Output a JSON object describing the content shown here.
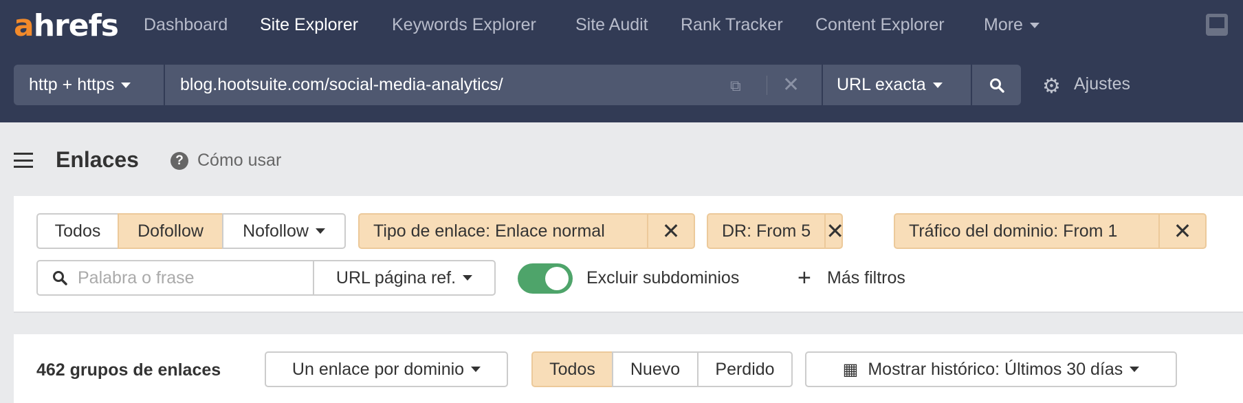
{
  "header": {
    "logo": "ahrefs",
    "logo_accent": "a",
    "logo_rest": "hrefs",
    "nav": [
      "Dashboard",
      "Site Explorer",
      "Keywords Explorer",
      "Site Audit",
      "Rank Tracker",
      "Content Explorer",
      "More"
    ],
    "active": "Site Explorer"
  },
  "search": {
    "protocol": "http + https",
    "url": "blog.hootsuite.com/social-media-analytics/",
    "mode": "URL exacta",
    "settings": "Ajustes"
  },
  "page": {
    "title": "Enlaces",
    "howto": "Cómo usar"
  },
  "filters": {
    "link_types": [
      "Todos",
      "Dofollow",
      "Nofollow"
    ],
    "selected_link_type": "Dofollow",
    "chips": [
      "Tipo de enlace: Enlace normal",
      "DR: From 5",
      "Tráfico del dominio: From 1"
    ],
    "search_placeholder": "Palabra o frase",
    "search_scope": "URL página ref.",
    "exclude_subdomains": "Excluir subdominios",
    "exclude_subdomains_on": true,
    "more_filters": "Más filtros"
  },
  "results": {
    "count_label": "462 grupos de enlaces",
    "grouping": "Un enlace por dominio",
    "status": [
      "Todos",
      "Nuevo",
      "Perdido"
    ],
    "selected_status": "Todos",
    "history": "Mostrar histórico: Últimos 30 días"
  },
  "colors": {
    "header": "#323b55",
    "accent": "#f28a2b",
    "chip": "#f8ddb8",
    "toggle": "#4ea46a"
  }
}
